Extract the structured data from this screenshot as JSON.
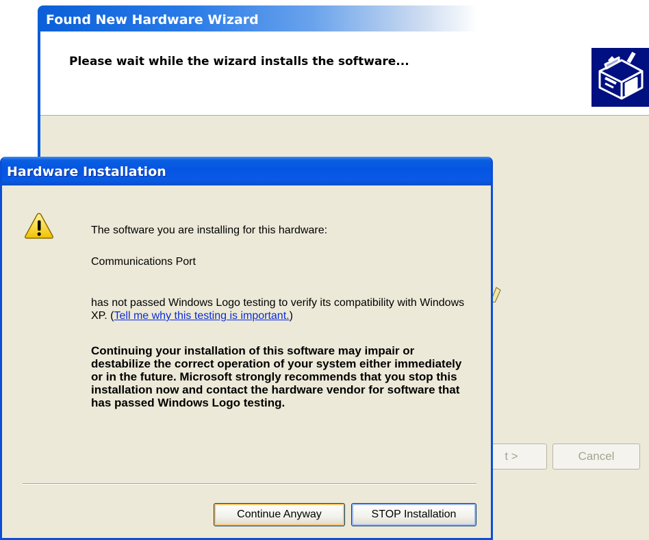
{
  "wizard": {
    "title": "Found New Hardware Wizard",
    "heading": "Please wait while the wizard installs the software...",
    "next_label": "Next >",
    "next_visible": "t >",
    "cancel_label": "Cancel",
    "icon": "hardware-install-icon"
  },
  "dialog": {
    "title": "Hardware Installation",
    "icon": "warning-icon",
    "intro_text": "The software you are installing for this hardware:",
    "device_name": "Communications Port",
    "logo_text": "has not passed Windows Logo testing to verify its compatibility with Windows XP. (",
    "logo_link": "Tell me why this testing is important.",
    "logo_text_end": ")",
    "warning_text": "Continuing your installation of this software may impair or destabilize the correct operation of your system either immediately or in the future. Microsoft strongly recommends that you stop this installation now and contact the hardware vendor for software that has passed Windows Logo testing.",
    "continue_label": "Continue Anyway",
    "stop_label": "STOP Installation"
  },
  "colors": {
    "titlebar_blue": "#0554e3",
    "dialog_face": "#ece9d8",
    "link_blue": "#0a2bd6",
    "focus_orange": "#f5c163"
  }
}
